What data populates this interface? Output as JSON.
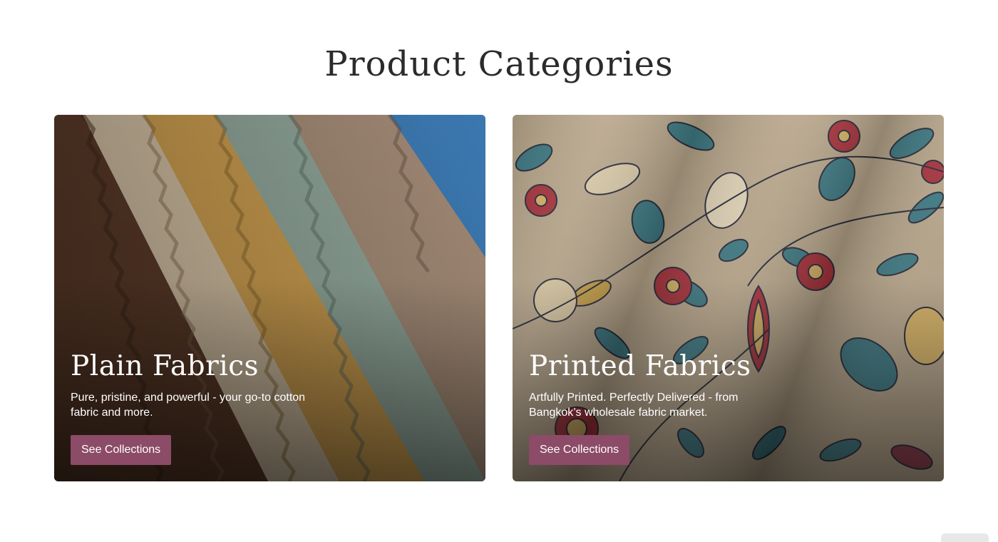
{
  "section": {
    "title": "Product Categories"
  },
  "cards": [
    {
      "title": "Plain Fabrics",
      "description": " Pure, pristine, and powerful - your go-to cotton fabric and more.",
      "button_label": "See Collections"
    },
    {
      "title": "Printed Fabrics",
      "description": "Artfully Printed. Perfectly Delivered - from Bangkok’s wholesale fabric market.",
      "button_label": "See Collections"
    }
  ],
  "colors": {
    "button": "#8c4b66",
    "title_text": "#2b2b2b",
    "card_text": "#ffffff"
  }
}
